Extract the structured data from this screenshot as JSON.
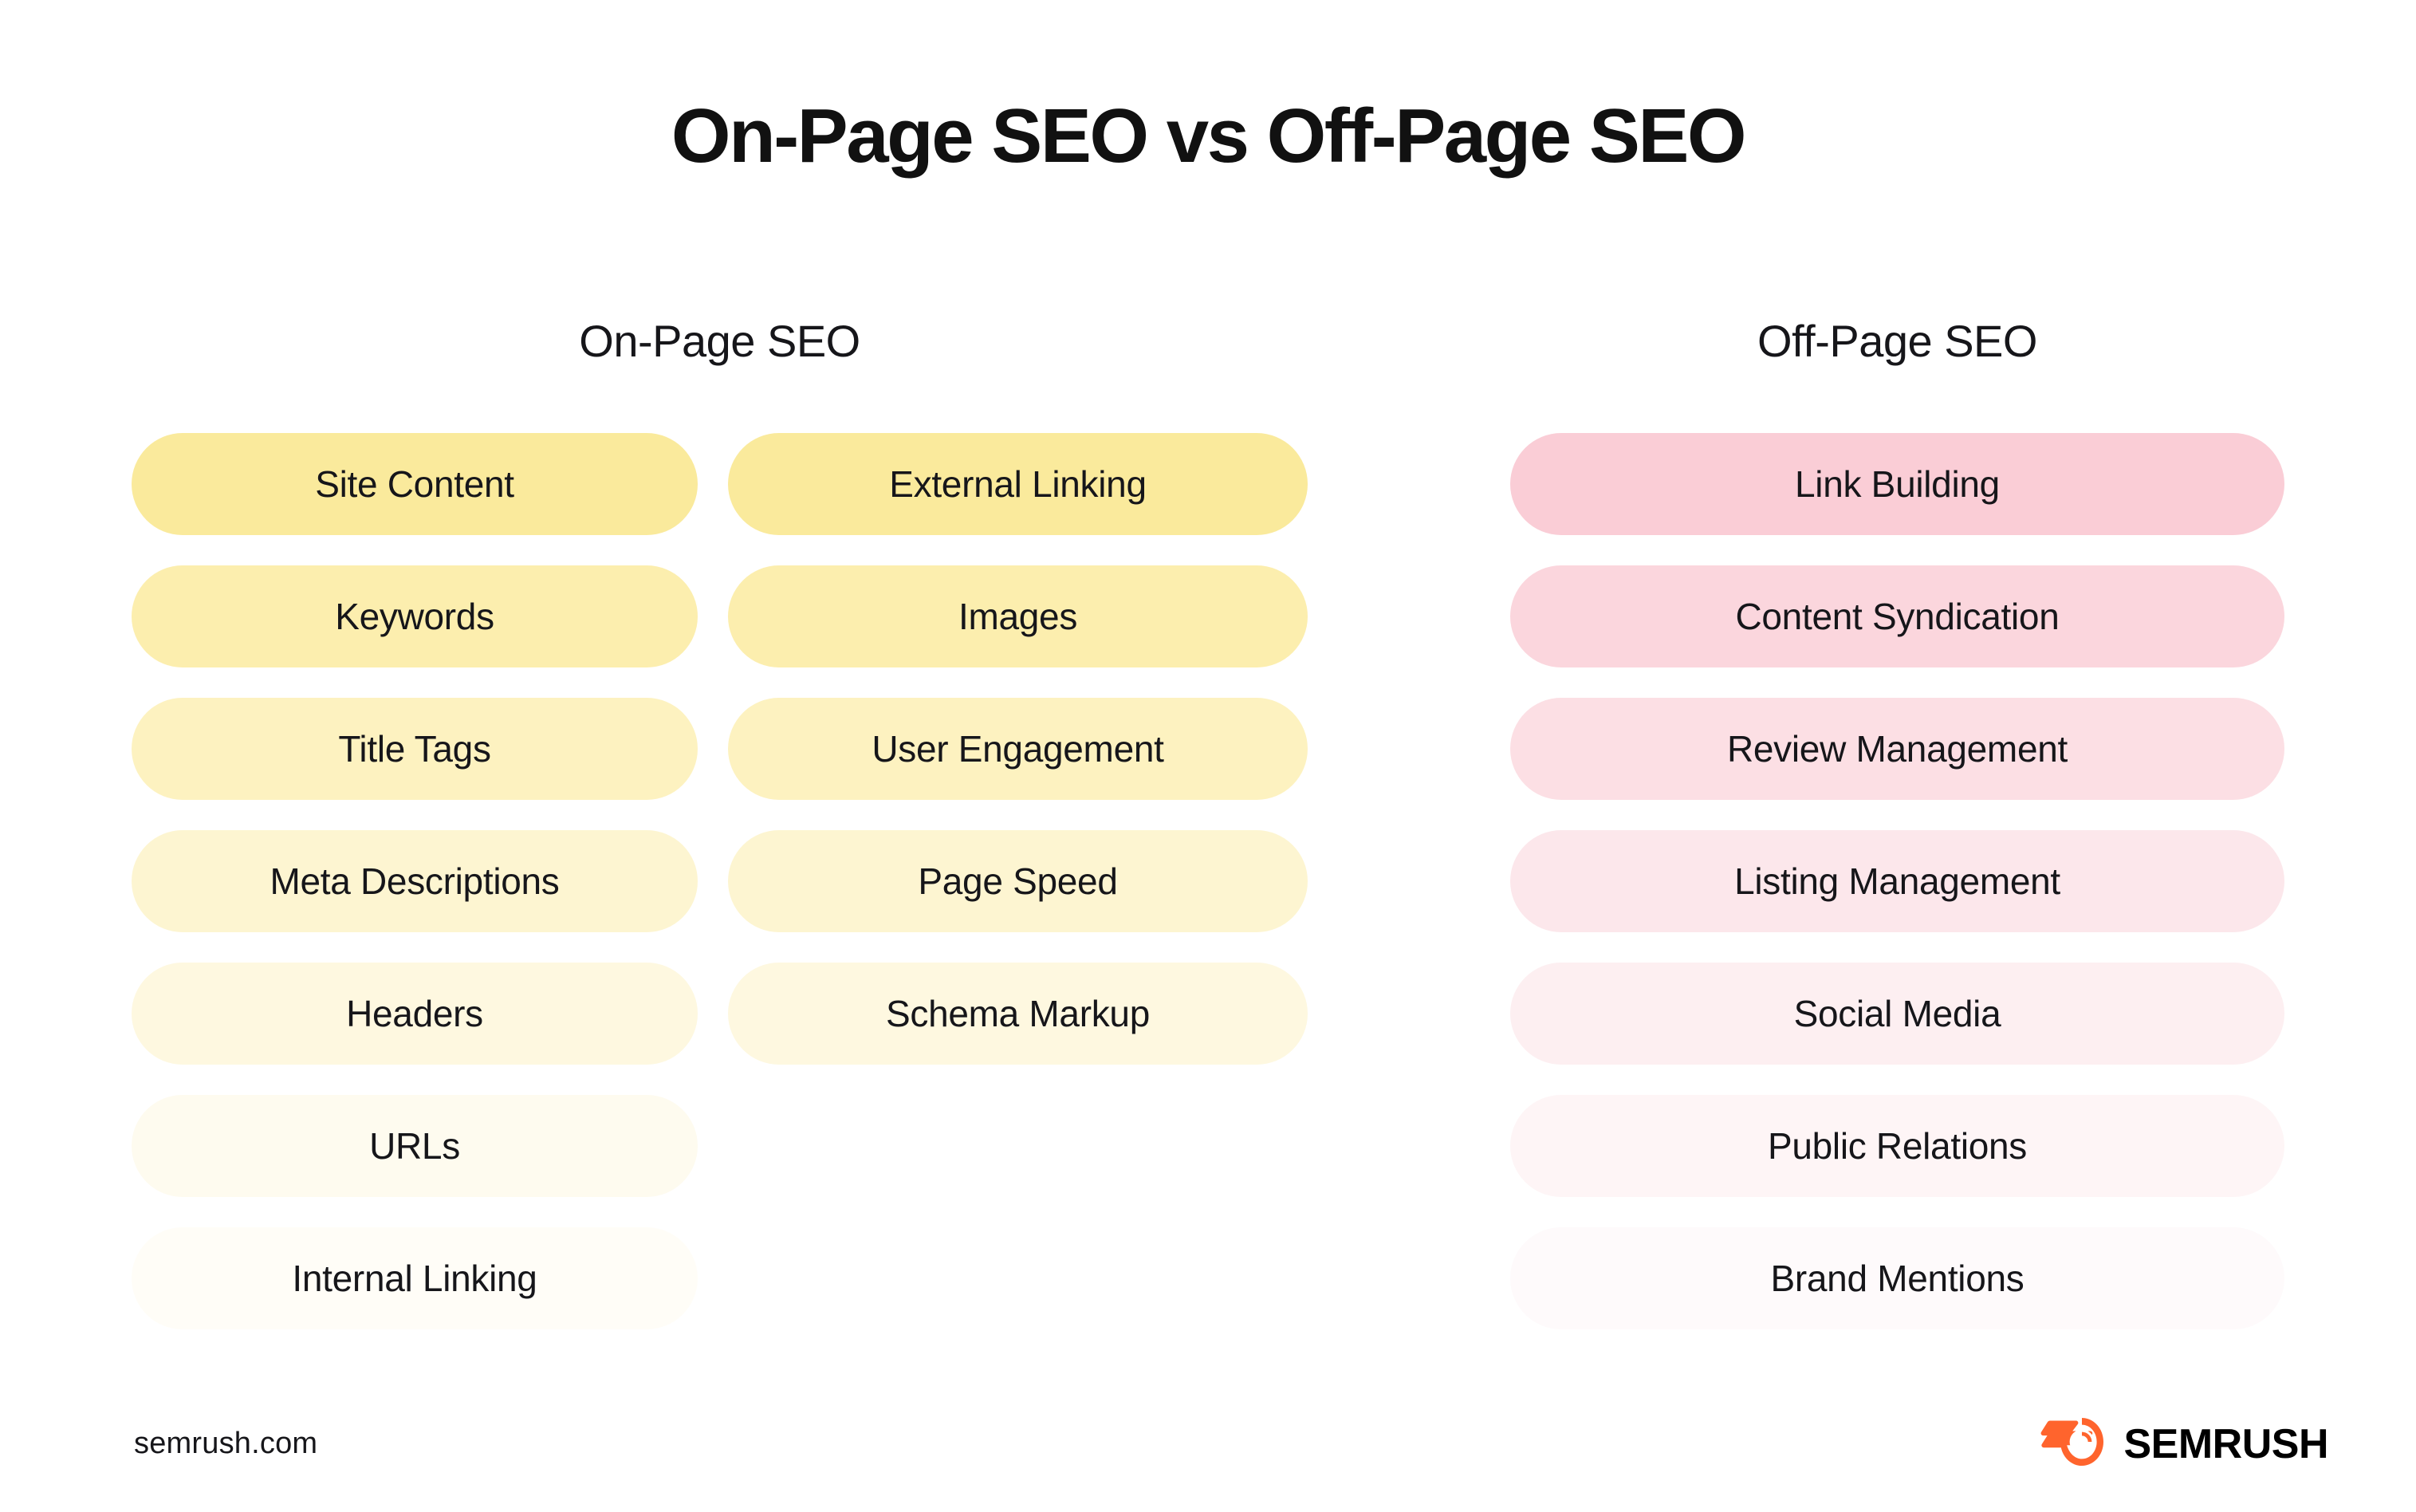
{
  "title": "On-Page SEO vs Off-Page SEO",
  "columns": {
    "on_page": {
      "heading": "On-Page SEO",
      "accent_color": "#FAEA9C",
      "group_a": [
        {
          "label": "Site Content",
          "color": "#FAEA9C"
        },
        {
          "label": "Keywords",
          "color": "#FCEEAE"
        },
        {
          "label": "Title Tags",
          "color": "#FDF2C0"
        },
        {
          "label": "Meta Descriptions",
          "color": "#FDF5D1"
        },
        {
          "label": "Headers",
          "color": "#FEF8E0"
        },
        {
          "label": "URLs",
          "color": "#FEFBEF"
        },
        {
          "label": "Internal Linking",
          "color": "#FFFDF7"
        }
      ],
      "group_b": [
        {
          "label": "External Linking",
          "color": "#FAEA9C"
        },
        {
          "label": "Images",
          "color": "#FCEEAE"
        },
        {
          "label": "User Engagement",
          "color": "#FDF2C0"
        },
        {
          "label": "Page Speed",
          "color": "#FDF5D1"
        },
        {
          "label": "Schema Markup",
          "color": "#FEF8E0"
        }
      ]
    },
    "off_page": {
      "heading": "Off-Page SEO",
      "accent_color": "#FACDD6",
      "items": [
        {
          "label": "Link Building",
          "color": "#FACDD6"
        },
        {
          "label": "Content Syndication",
          "color": "#FBD6DD"
        },
        {
          "label": "Review Management",
          "color": "#FCDFE4"
        },
        {
          "label": "Listing Management",
          "color": "#FCE7EB"
        },
        {
          "label": "Social Media",
          "color": "#FDEFF1"
        },
        {
          "label": "Public Relations",
          "color": "#FEF5F6"
        },
        {
          "label": "Brand Mentions",
          "color": "#FEFAFB"
        }
      ]
    }
  },
  "footer": {
    "url": "semrush.com",
    "logo_wordmark": "SEMRUSH",
    "logo_icon": "semrush-comet-icon",
    "logo_color": "#FF642D"
  }
}
